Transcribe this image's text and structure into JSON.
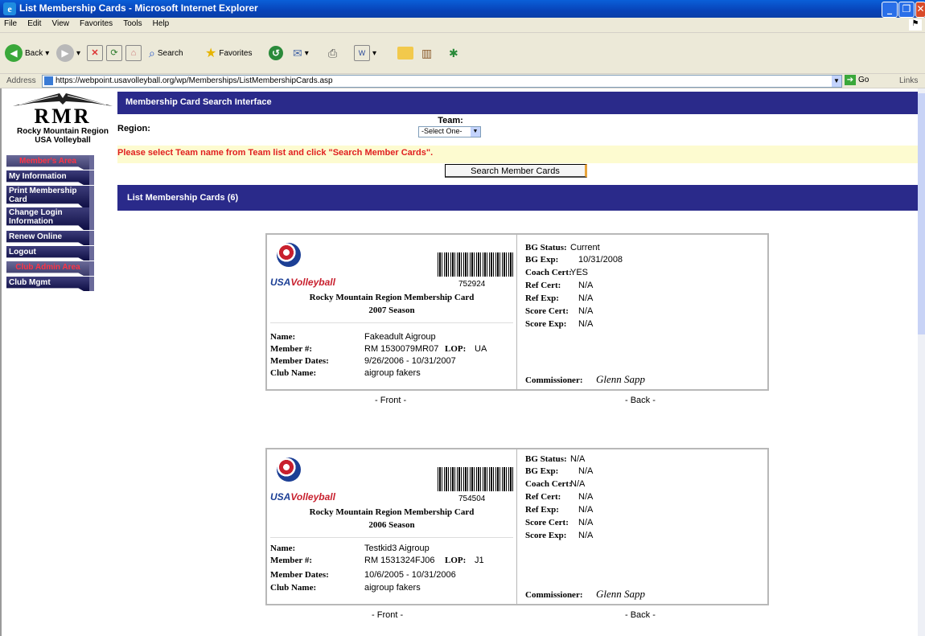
{
  "window": {
    "title": "List Membership Cards - Microsoft Internet Explorer"
  },
  "menu": [
    "File",
    "Edit",
    "View",
    "Favorites",
    "Tools",
    "Help"
  ],
  "toolbar": {
    "back": "Back",
    "search": "Search",
    "favorites": "Favorites"
  },
  "address": {
    "label": "Address",
    "url": "https://webpoint.usavolleyball.org/wp/Memberships/ListMembershipCards.asp",
    "go": "Go",
    "links": "Links"
  },
  "logo": {
    "letters": "RMR",
    "line1": "Rocky Mountain Region",
    "line2": "USA Volleyball"
  },
  "sidebar": {
    "members_header": "Member's Area",
    "items": [
      "My Information",
      "Print Membership Card",
      "Change Login Information",
      "Renew Online",
      "Logout"
    ],
    "club_header": "Club Admin Area",
    "club_items": [
      "Club Mgmt"
    ]
  },
  "search": {
    "header": "Membership Card Search Interface",
    "region_label": "Region:",
    "team_label": "Team:",
    "team_select": "-Select One-",
    "notice": "Please select Team name from Team list and click \"Search Member Cards\".",
    "button": "Search Member Cards"
  },
  "list": {
    "header": "List Membership Cards (6)"
  },
  "cards": [
    {
      "logo_text_a": "USA",
      "logo_text_b": "Volleyball",
      "number": "752924",
      "title": "Rocky Mountain Region Membership Card",
      "season": "2007 Season",
      "labels": {
        "name": "Name:",
        "member": "Member #:",
        "dates": "Member Dates:",
        "club": "Club Name:",
        "lop": "LOP:"
      },
      "name": "Fakeadult Aigroup",
      "member_no": "RM 1530079MR07",
      "lop": "UA",
      "dates": "9/26/2006 - 10/31/2007",
      "club": "aigroup fakers",
      "back": [
        {
          "label": "BG Status:",
          "value": "Current"
        },
        {
          "label": "BG Exp:",
          "value": "10/31/2008"
        },
        {
          "label": "Coach Cert:",
          "value": "YES"
        },
        {
          "label": "Ref Cert:",
          "value": "N/A"
        },
        {
          "label": "Ref Exp:",
          "value": "N/A"
        },
        {
          "label": "Score Cert:",
          "value": "N/A"
        },
        {
          "label": "Score Exp:",
          "value": "N/A"
        }
      ],
      "commissioner_label": "Commissioner:",
      "commissioner": "Glenn Sapp",
      "front_caption": "- Front -",
      "back_caption": "- Back -"
    },
    {
      "logo_text_a": "USA",
      "logo_text_b": "Volleyball",
      "number": "754504",
      "title": "Rocky Mountain Region Membership Card",
      "season": "2006 Season",
      "labels": {
        "name": "Name:",
        "member": "Member #:",
        "dates": "Member Dates:",
        "club": "Club Name:",
        "lop": "LOP:"
      },
      "name": "Testkid3 Aigroup",
      "member_no": "RM 1531324FJ06",
      "lop": "J1",
      "dates": "10/6/2005 - 10/31/2006",
      "club": "aigroup fakers",
      "back": [
        {
          "label": "BG Status:",
          "value": "N/A"
        },
        {
          "label": "BG Exp:",
          "value": "N/A"
        },
        {
          "label": "Coach Cert:",
          "value": "N/A"
        },
        {
          "label": "Ref Cert:",
          "value": "N/A"
        },
        {
          "label": "Ref Exp:",
          "value": "N/A"
        },
        {
          "label": "Score Cert:",
          "value": "N/A"
        },
        {
          "label": "Score Exp:",
          "value": "N/A"
        }
      ],
      "commissioner_label": "Commissioner:",
      "commissioner": "Glenn Sapp",
      "front_caption": "- Front -",
      "back_caption": "- Back -"
    }
  ]
}
